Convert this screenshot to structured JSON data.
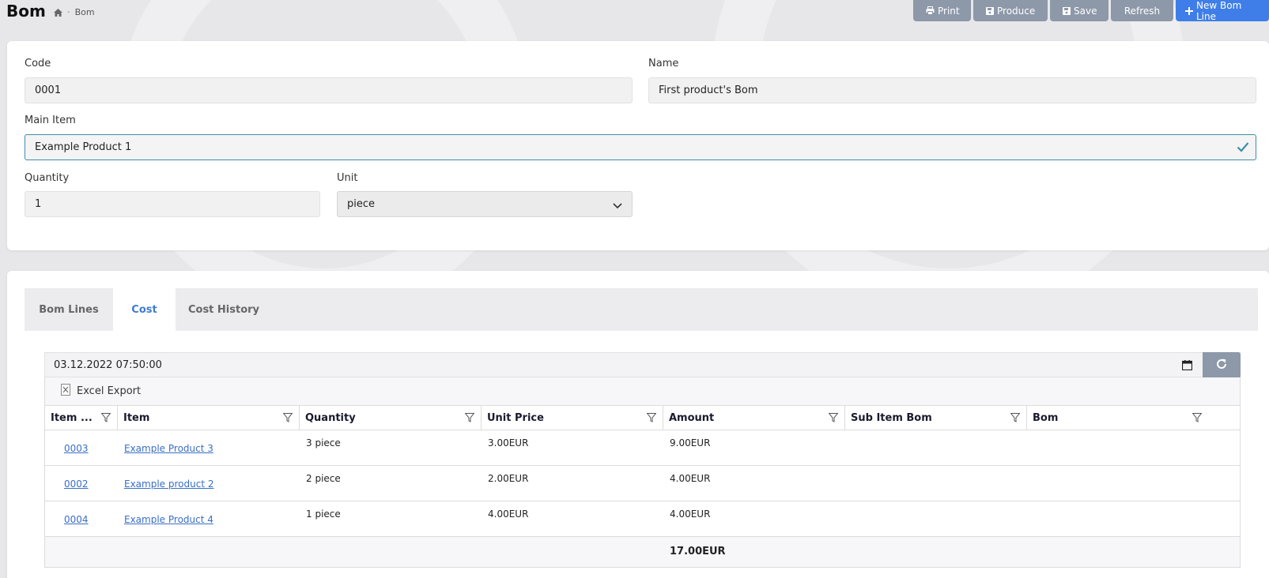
{
  "header": {
    "title": "Bom",
    "breadcrumb": [
      "Bom"
    ],
    "separator": "-"
  },
  "toolbar": {
    "print_label": "Print",
    "produce_label": "Produce",
    "save_label": "Save",
    "refresh_label": "Refresh",
    "new_label": "New Bom Line"
  },
  "form": {
    "code_label": "Code",
    "code_value": "0001",
    "name_label": "Name",
    "name_value": "First product's Bom",
    "main_item_label": "Main Item",
    "main_item_value": "Example Product 1",
    "quantity_label": "Quantity",
    "quantity_value": "1",
    "unit_label": "Unit",
    "unit_value": "piece"
  },
  "tabs": [
    {
      "label": "Bom Lines",
      "active": false
    },
    {
      "label": "Cost",
      "active": true
    },
    {
      "label": "Cost History",
      "active": false
    }
  ],
  "cost": {
    "date_value": "03.12.2022 07:50:00",
    "excel_label": "Excel Export",
    "columns": [
      "Item ...",
      "Item",
      "Quantity",
      "Unit Price",
      "Amount",
      "Sub Item Bom",
      "Bom"
    ],
    "rows": [
      {
        "code": "0003",
        "item": "Example Product 3",
        "quantity": "3 piece",
        "unit_price": "3.00EUR",
        "amount": "9.00EUR",
        "sub_item_bom": "",
        "bom": ""
      },
      {
        "code": "0002",
        "item": "Example product 2",
        "quantity": "2 piece",
        "unit_price": "2.00EUR",
        "amount": "4.00EUR",
        "sub_item_bom": "",
        "bom": ""
      },
      {
        "code": "0004",
        "item": "Example Product 4",
        "quantity": "1 piece",
        "unit_price": "4.00EUR",
        "amount": "4.00EUR",
        "sub_item_bom": "",
        "bom": ""
      }
    ],
    "total": "17.00EUR"
  },
  "colors": {
    "primary": "#3f7ee8",
    "secondary_button": "#8d98a9",
    "link": "#3a6fc5",
    "valid_border": "#3d8fa8"
  }
}
